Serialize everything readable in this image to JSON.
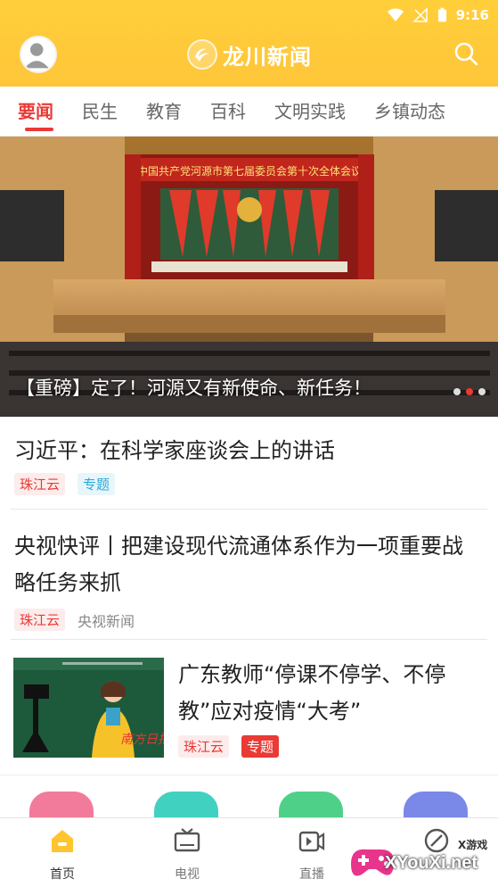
{
  "status": {
    "time": "9:16"
  },
  "header": {
    "title": "龙川新闻"
  },
  "tabs": [
    "要闻",
    "民生",
    "教育",
    "百科",
    "文明实践",
    "乡镇动态"
  ],
  "banner": {
    "caption": "【重磅】定了！河源又有新使命、新任务！",
    "slogan": "中国共产党河源市第七届委员会第十次全体会议"
  },
  "news": [
    {
      "title": "习近平：在科学家座谈会上的讲话",
      "tags": [
        "珠江云",
        "专题"
      ]
    },
    {
      "title": "央视快评丨把建设现代流通体系作为一项重要战略任务来抓",
      "tags": [
        "珠江云",
        "央视新闻"
      ]
    },
    {
      "title": "广东教师“停课不停学、不停教”应对疫情“大考”",
      "tags": [
        "珠江云",
        "专题"
      ]
    }
  ],
  "bottom_nav": [
    "首页",
    "电视",
    "直播"
  ],
  "watermark": {
    "text": "XYouXi.net",
    "small": "X游戏"
  },
  "colors": {
    "brand_yellow": "#ffc93a",
    "accent_red": "#e93a35"
  }
}
